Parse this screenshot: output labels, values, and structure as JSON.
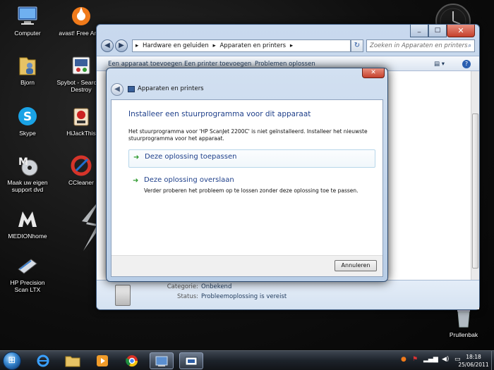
{
  "desktop": {
    "icons": [
      {
        "label": "Computer",
        "icon": "computer-icon"
      },
      {
        "label": "avast! Free Antiv",
        "icon": "avast-icon"
      },
      {
        "label": "Bjorn",
        "icon": "user-folder-icon"
      },
      {
        "label": "Spybot - Search & Destroy",
        "icon": "spybot-icon"
      },
      {
        "label": "Skype",
        "icon": "skype-icon"
      },
      {
        "label": "HiJackThis",
        "icon": "hijackthis-icon"
      },
      {
        "label": "Maak uw eigen support dvd",
        "icon": "dvd-icon"
      },
      {
        "label": "CCleaner",
        "icon": "ccleaner-icon"
      },
      {
        "label": "MEDIONhome",
        "icon": "medion-icon"
      },
      {
        "label": "HP Precision Scan LTX",
        "icon": "scanner-icon"
      },
      {
        "label": "Prullenbak",
        "icon": "recycle-bin-icon"
      }
    ]
  },
  "explorer": {
    "address": {
      "crumbs": [
        "Hardware en geluiden",
        "Apparaten en printers"
      ]
    },
    "search_placeholder": "Zoeken in Apparaten en printers",
    "toolbar": {
      "add_device": "Een apparaat toevoegen",
      "add_printer": "Een printer toevoegen",
      "troubleshoot": "Problemen oplossen"
    },
    "details": {
      "category_label": "Categorie:",
      "category_value": "Onbekend",
      "status_label": "Status:",
      "status_value": "Probleemoplossing is vereist"
    }
  },
  "dialog": {
    "title": "Apparaten en printers",
    "heading": "Installeer een stuurprogramma voor dit apparaat",
    "description": "Het stuurprogramma voor 'HP ScanJet 2200C' is niet geïnstalleerd. Installeer het nieuwste stuurprogramma voor het apparaat.",
    "option_apply": {
      "title": "Deze oplossing toepassen"
    },
    "option_skip": {
      "title": "Deze oplossing overslaan",
      "subtitle": "Verder proberen het probleem op te lossen zonder deze oplossing toe te passen."
    },
    "cancel_label": "Annuleren"
  },
  "taskbar": {
    "clock_time": "18:18",
    "clock_date": "25/06/2011"
  },
  "colors": {
    "link_blue": "#1e3f8a",
    "arrow_green": "#2f9a2f",
    "close_red": "#c5402c"
  }
}
